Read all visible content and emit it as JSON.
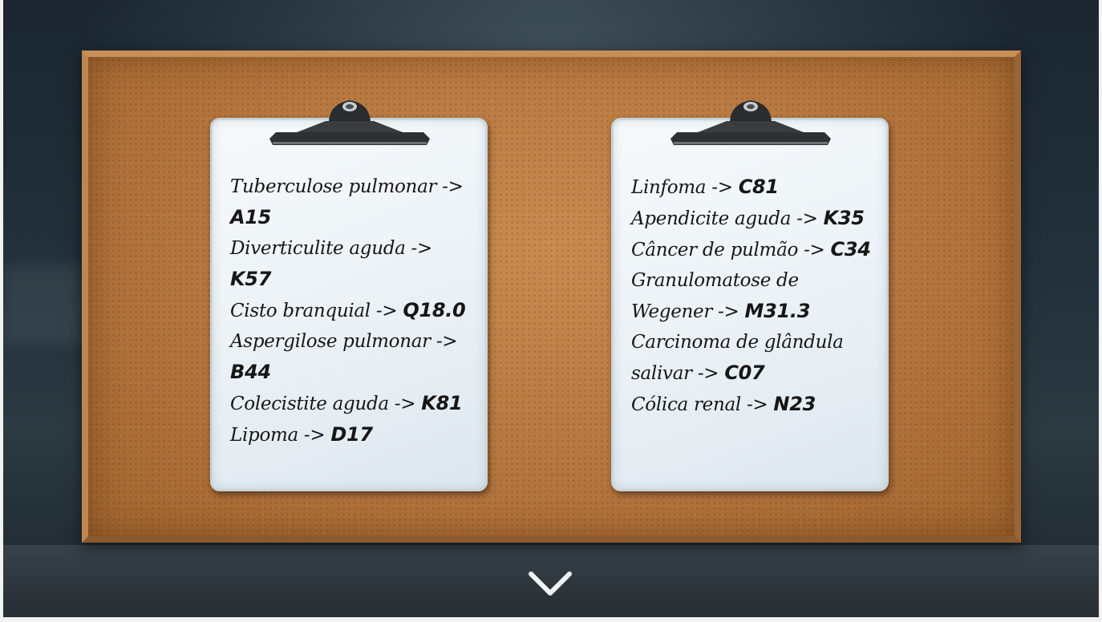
{
  "board": {
    "left_clipboard": {
      "items": [
        {
          "text": "Tuberculose pulmonar ->",
          "code": "A15"
        },
        {
          "text": "Diverticulite aguda ->",
          "code": "K57"
        },
        {
          "text": "Cisto branquial ->",
          "code": "Q18.0"
        },
        {
          "text": "Aspergilose pulmonar ->",
          "code": "B44"
        },
        {
          "text": "Colecistite aguda ->",
          "code": "K81"
        },
        {
          "text": "Lipoma ->",
          "code": "D17"
        }
      ]
    },
    "right_clipboard": {
      "items": [
        {
          "text": "Linfoma ->",
          "code": "C81"
        },
        {
          "text": "Apendicite aguda ->",
          "code": "K35"
        },
        {
          "text": "Câncer de pulmão ->",
          "code": "C34"
        },
        {
          "text": "Granulomatose de Wegener ->",
          "code": "M31.3"
        },
        {
          "text": "Carcinoma de glândula salivar ->",
          "code": "C07"
        },
        {
          "text": "Cólica renal ->",
          "code": "N23"
        }
      ]
    }
  },
  "icons": {
    "scroll_down": "chevron-down-icon",
    "clip": "clipboard-clip-icon"
  },
  "colors": {
    "cork": "#b97a42",
    "frame": "#b07a45",
    "paper": "#eef3f7",
    "ink": "#161616"
  }
}
